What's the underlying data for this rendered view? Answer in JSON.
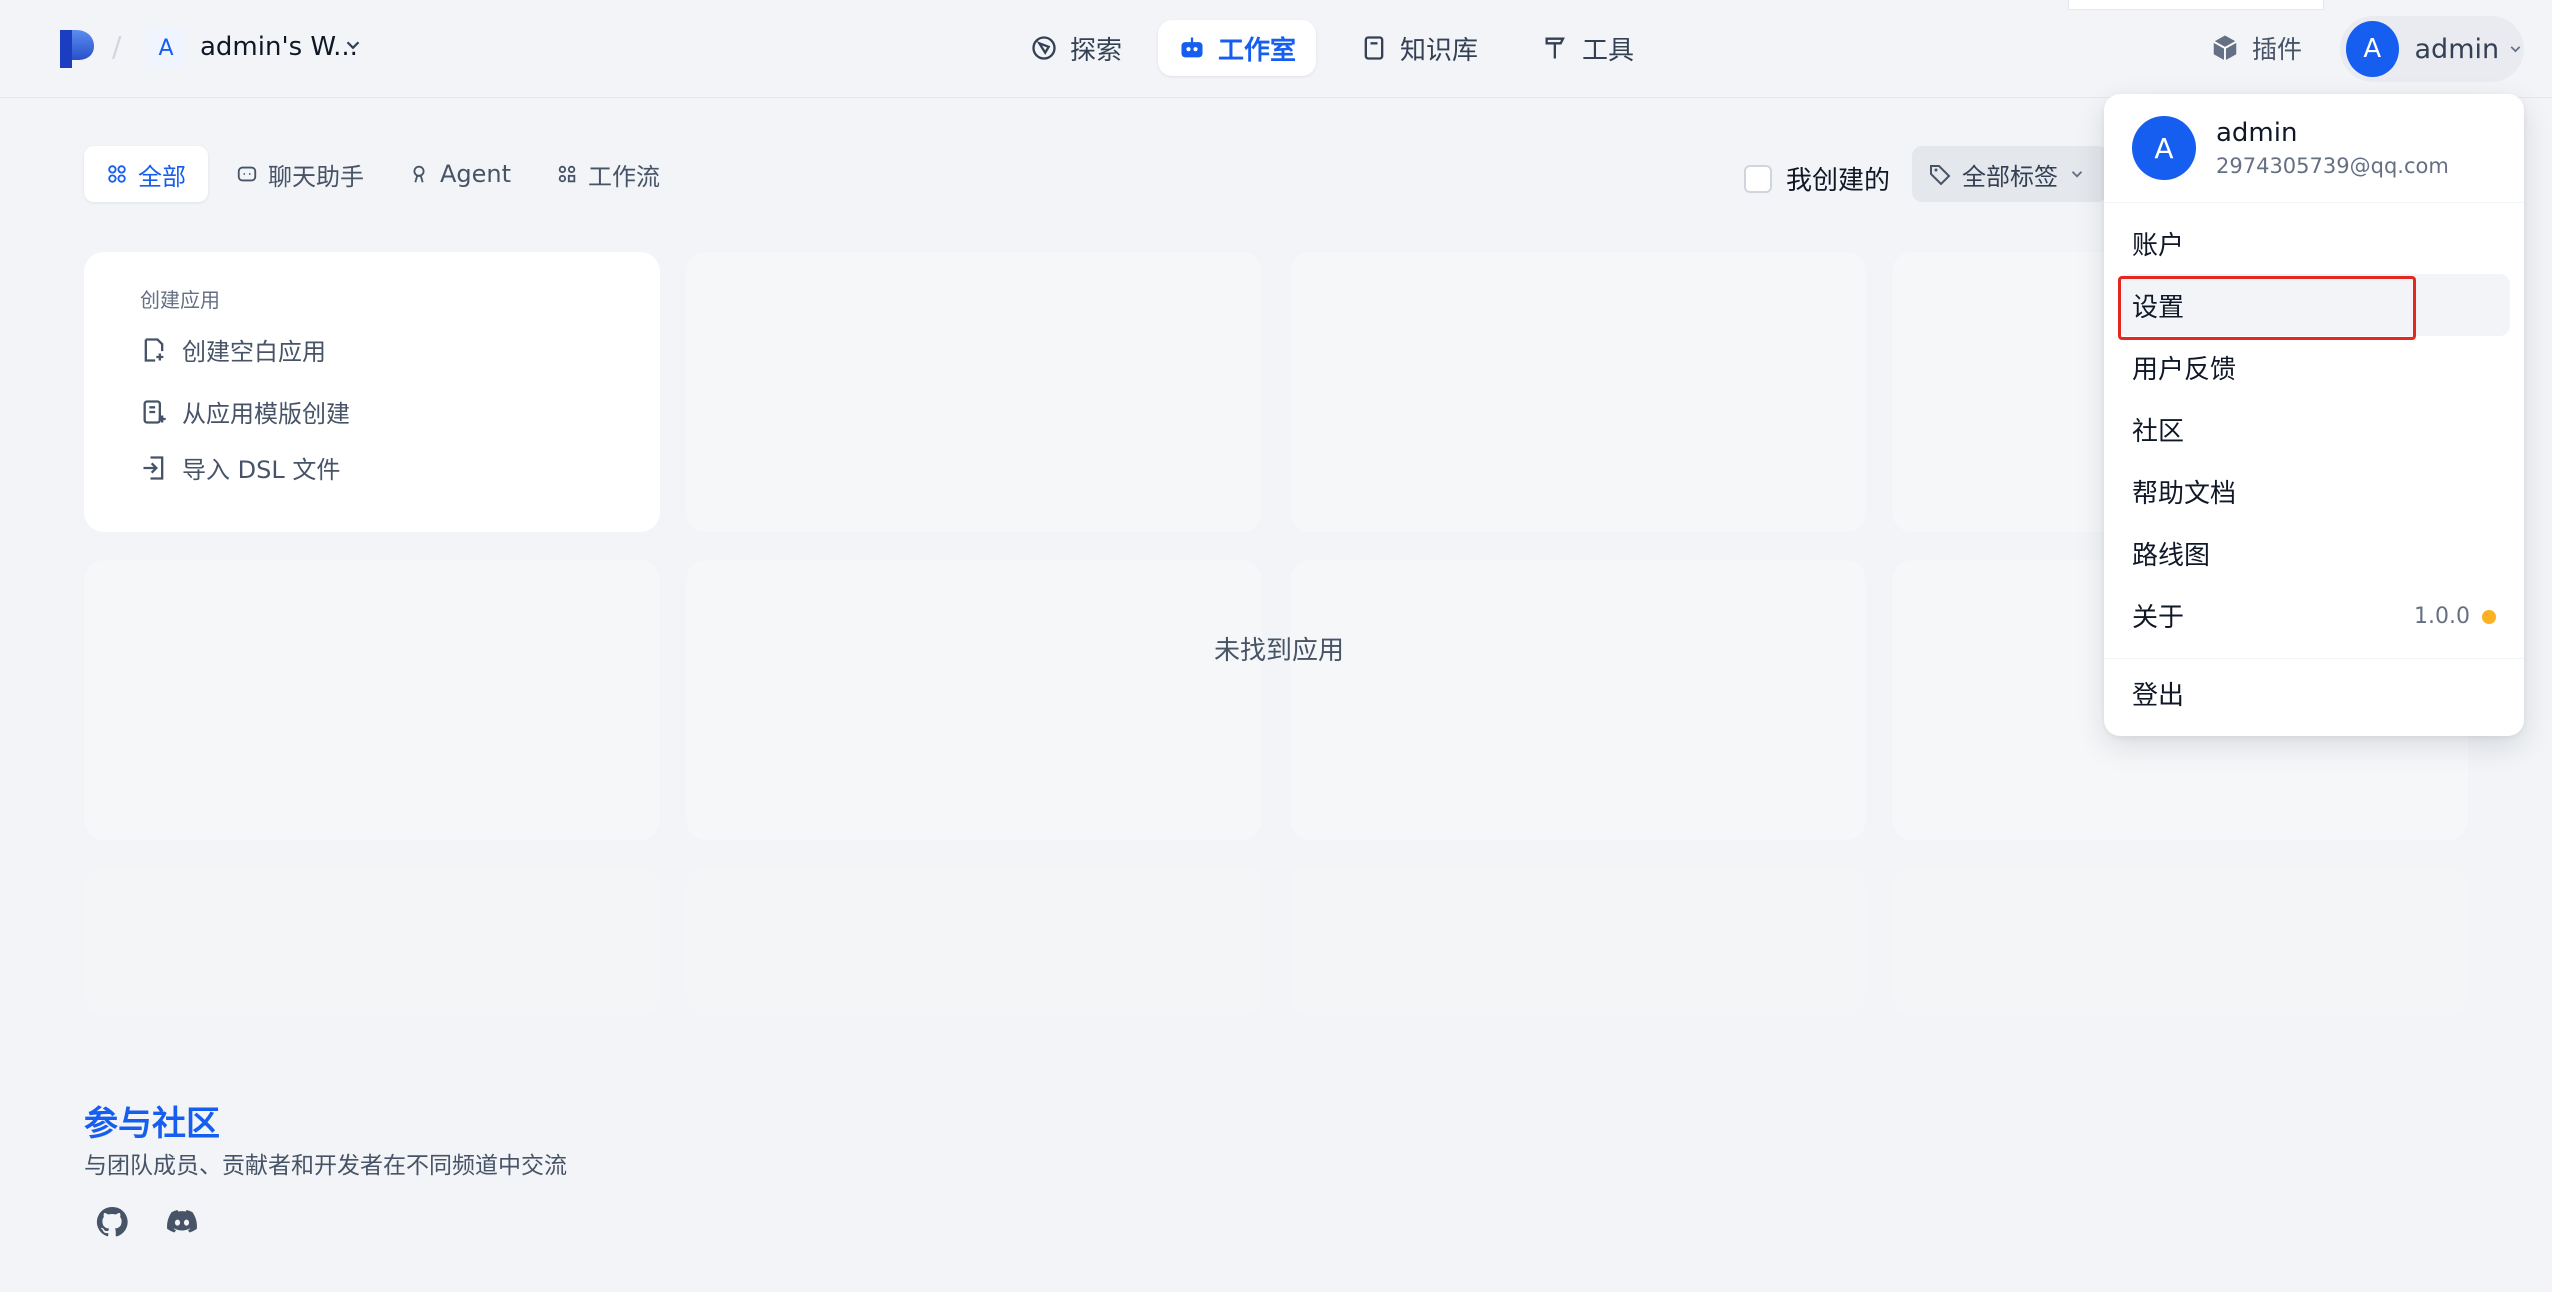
{
  "workspace": {
    "avatar": "A",
    "name": "admin's W..."
  },
  "nav": [
    {
      "label": "探索",
      "icon": "compass-icon"
    },
    {
      "label": "工作室",
      "icon": "robot-icon"
    },
    {
      "label": "知识库",
      "icon": "book-icon"
    },
    {
      "label": "工具",
      "icon": "hammer-icon"
    }
  ],
  "header": {
    "plugins_label": "插件",
    "user_avatar": "A",
    "user_name": "admin"
  },
  "tabs": [
    {
      "label": "全部"
    },
    {
      "label": "聊天助手"
    },
    {
      "label": "Agent"
    },
    {
      "label": "工作流"
    }
  ],
  "filters": {
    "mine_label": "我创建的",
    "tags_label": "全部标签"
  },
  "create": {
    "title": "创建应用",
    "blank": "创建空白应用",
    "template": "从应用模版创建",
    "dsl": "导入 DSL 文件"
  },
  "empty_text": "未找到应用",
  "community": {
    "title": "参与社区",
    "subtitle": "与团队成员、贡献者和开发者在不同频道中交流"
  },
  "menu": {
    "avatar": "A",
    "name": "admin",
    "email": "2974305739@qq.com",
    "items": {
      "account": "账户",
      "settings": "设置",
      "feedback": "用户反馈",
      "community": "社区",
      "help": "帮助文档",
      "roadmap": "路线图",
      "about": "关于",
      "logout": "登出"
    },
    "version": "1.0.0"
  },
  "colors": {
    "accent": "#155eef",
    "highlight": "#e5281f",
    "version_dot": "#fdb022"
  }
}
